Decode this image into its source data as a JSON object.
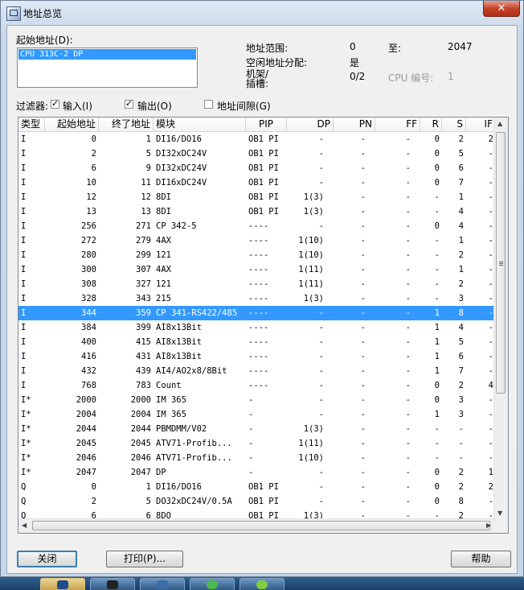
{
  "window": {
    "title": "地址总览",
    "close_glyph": "✕"
  },
  "start_address": {
    "label": "起始地址(D):",
    "items": [
      "CPU 313C-2 DP"
    ]
  },
  "range": {
    "range_label": "地址范围:",
    "range_from": "0",
    "to_label": "至:",
    "range_to": "2047",
    "free_label": "空闲地址分配:",
    "free_value": "是",
    "rack_label": "机架/\n插槽:",
    "rack_value": "0/2",
    "cpu_label": "CPU 编号:",
    "cpu_value": "1"
  },
  "filter": {
    "label": "过滤器:",
    "input": "输入(I)",
    "output": "输出(O)",
    "gaps": "地址间隙(G)"
  },
  "table": {
    "headers": [
      "类型",
      "起始地址",
      "终了地址",
      "模块",
      "PIP",
      "DP",
      "PN",
      "FF",
      "R",
      "S",
      "IF"
    ],
    "rows": [
      [
        "I",
        "0",
        "1",
        "DI16/DO16",
        "OB1 PI",
        "-",
        "-",
        "-",
        "0",
        "2",
        "2"
      ],
      [
        "I",
        "2",
        "5",
        "DI32xDC24V",
        "OB1 PI",
        "-",
        "-",
        "-",
        "0",
        "5",
        "-"
      ],
      [
        "I",
        "6",
        "9",
        "DI32xDC24V",
        "OB1 PI",
        "-",
        "-",
        "-",
        "0",
        "6",
        "-"
      ],
      [
        "I",
        "10",
        "11",
        "DI16xDC24V",
        "OB1 PI",
        "-",
        "-",
        "-",
        "0",
        "7",
        "-"
      ],
      [
        "I",
        "12",
        "12",
        "8DI",
        "OB1 PI",
        "1(3)",
        "-",
        "-",
        "-",
        "1",
        "-"
      ],
      [
        "I",
        "13",
        "13",
        "8DI",
        "OB1 PI",
        "1(3)",
        "-",
        "-",
        "-",
        "4",
        "-"
      ],
      [
        "I",
        "256",
        "271",
        "CP 342-5",
        "----",
        "-",
        "-",
        "-",
        "0",
        "4",
        "-"
      ],
      [
        "I",
        "272",
        "279",
        "4AX",
        "----",
        "1(10)",
        "-",
        "-",
        "-",
        "1",
        "-"
      ],
      [
        "I",
        "280",
        "299",
        "121",
        "----",
        "1(10)",
        "-",
        "-",
        "-",
        "2",
        "-"
      ],
      [
        "I",
        "300",
        "307",
        "4AX",
        "----",
        "1(11)",
        "-",
        "-",
        "-",
        "1",
        "-"
      ],
      [
        "I",
        "308",
        "327",
        "121",
        "----",
        "1(11)",
        "-",
        "-",
        "-",
        "2",
        "-"
      ],
      [
        "I",
        "328",
        "343",
        "215",
        "----",
        "1(3)",
        "-",
        "-",
        "-",
        "3",
        "-"
      ],
      [
        "I",
        "344",
        "359",
        "CP 341-RS422/485",
        "----",
        "-",
        "-",
        "-",
        "1",
        "8",
        "-"
      ],
      [
        "I",
        "384",
        "399",
        "AI8x13Bit",
        "----",
        "-",
        "-",
        "-",
        "1",
        "4",
        "-"
      ],
      [
        "I",
        "400",
        "415",
        "AI8x13Bit",
        "----",
        "-",
        "-",
        "-",
        "1",
        "5",
        "-"
      ],
      [
        "I",
        "416",
        "431",
        "AI8x13Bit",
        "----",
        "-",
        "-",
        "-",
        "1",
        "6",
        "-"
      ],
      [
        "I",
        "432",
        "439",
        "AI4/AO2x8/8Bit",
        "----",
        "-",
        "-",
        "-",
        "1",
        "7",
        "-"
      ],
      [
        "I",
        "768",
        "783",
        "Count",
        "----",
        "-",
        "-",
        "-",
        "0",
        "2",
        "4"
      ],
      [
        "I*",
        "2000",
        "2000",
        "IM 365",
        "-",
        "-",
        "-",
        "-",
        "0",
        "3",
        "-"
      ],
      [
        "I*",
        "2004",
        "2004",
        "IM 365",
        "-",
        "-",
        "-",
        "-",
        "1",
        "3",
        "-"
      ],
      [
        "I*",
        "2044",
        "2044",
        "PBMDMM/V02",
        "-",
        "1(3)",
        "-",
        "-",
        "-",
        "-",
        "-"
      ],
      [
        "I*",
        "2045",
        "2045",
        "ATV71-Profib...",
        "-",
        "1(11)",
        "-",
        "-",
        "-",
        "-",
        "-"
      ],
      [
        "I*",
        "2046",
        "2046",
        "ATV71-Profib...",
        "-",
        "1(10)",
        "-",
        "-",
        "-",
        "-",
        "-"
      ],
      [
        "I*",
        "2047",
        "2047",
        "DP",
        "-",
        "-",
        "-",
        "-",
        "0",
        "2",
        "1"
      ],
      [
        "Q",
        "0",
        "1",
        "DI16/DO16",
        "OB1 PI",
        "-",
        "-",
        "-",
        "0",
        "2",
        "2"
      ],
      [
        "Q",
        "2",
        "5",
        "DO32xDC24V/0.5A",
        "OB1 PI",
        "-",
        "-",
        "-",
        "0",
        "8",
        "-"
      ],
      [
        "Q",
        "6",
        "6",
        "8DO",
        "OB1 PI",
        "1(3)",
        "-",
        "-",
        "-",
        "2",
        "-"
      ]
    ],
    "selected_row": 12
  },
  "buttons": {
    "close": "关闭",
    "print": "打印(P)...",
    "help": "帮助"
  },
  "colors": {
    "selection": "#3399ff",
    "close_red": "#c4422a"
  }
}
